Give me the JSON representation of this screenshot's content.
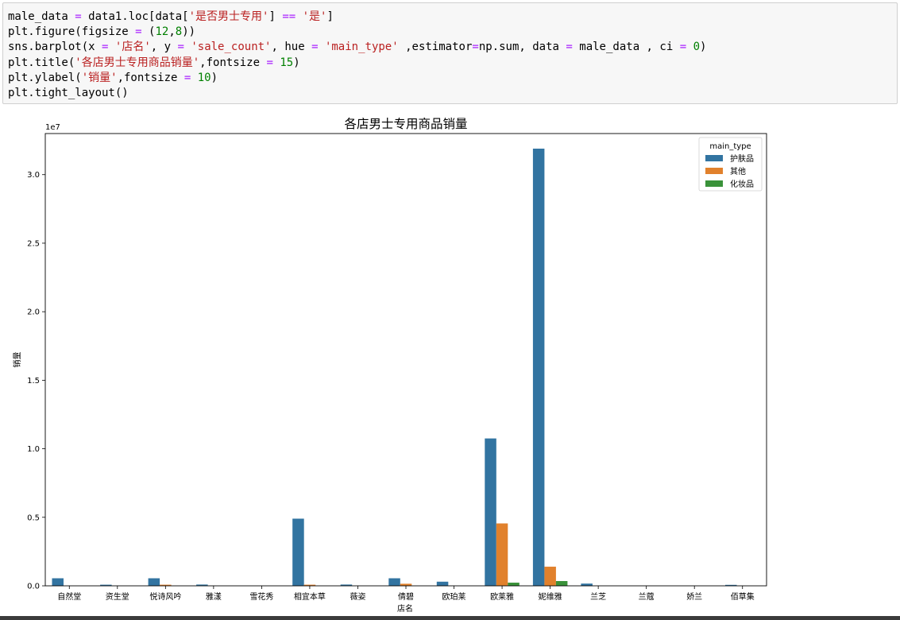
{
  "code_cell": {
    "lines": [
      [
        [
          "male_data ",
          ""
        ],
        [
          "=",
          "op"
        ],
        [
          " data1.loc[data[",
          ""
        ],
        [
          "'是否男士专用'",
          "str"
        ],
        [
          "] ",
          ""
        ],
        [
          "==",
          "op"
        ],
        [
          " ",
          ""
        ],
        [
          "'是'",
          "str"
        ],
        [
          "]",
          ""
        ]
      ],
      [
        [
          "plt.figure(figsize ",
          ""
        ],
        [
          "=",
          "op"
        ],
        [
          " (",
          ""
        ],
        [
          "12",
          "num"
        ],
        [
          ",",
          ""
        ],
        [
          "8",
          "num"
        ],
        [
          "))",
          ""
        ]
      ],
      [
        [
          "sns.barplot(x ",
          ""
        ],
        [
          "=",
          "op"
        ],
        [
          " ",
          ""
        ],
        [
          "'店名'",
          "str"
        ],
        [
          ", y ",
          ""
        ],
        [
          "=",
          "op"
        ],
        [
          " ",
          ""
        ],
        [
          "'sale_count'",
          "str"
        ],
        [
          ", hue ",
          ""
        ],
        [
          "=",
          "op"
        ],
        [
          " ",
          ""
        ],
        [
          "'main_type'",
          "str"
        ],
        [
          " ,estimator",
          ""
        ],
        [
          "=",
          "op"
        ],
        [
          "np.sum, data ",
          ""
        ],
        [
          "=",
          "op"
        ],
        [
          " male_data , ci ",
          ""
        ],
        [
          "=",
          "op"
        ],
        [
          " ",
          ""
        ],
        [
          "0",
          "num"
        ],
        [
          ")",
          ""
        ]
      ],
      [
        [
          "plt.title(",
          ""
        ],
        [
          "'各店男士专用商品销量'",
          "str"
        ],
        [
          ",fontsize ",
          ""
        ],
        [
          "=",
          "op"
        ],
        [
          " ",
          ""
        ],
        [
          "15",
          "num"
        ],
        [
          ")",
          ""
        ]
      ],
      [
        [
          "plt.ylabel(",
          ""
        ],
        [
          "'销量'",
          "str"
        ],
        [
          ",fontsize ",
          ""
        ],
        [
          "=",
          "op"
        ],
        [
          " ",
          ""
        ],
        [
          "10",
          "num"
        ],
        [
          ")",
          ""
        ]
      ],
      [
        [
          "plt.tight_layout()",
          ""
        ]
      ]
    ]
  },
  "chart_data": {
    "type": "bar",
    "title": "各店男士专用商品销量",
    "xlabel": "店名",
    "ylabel": "销量",
    "y_offset_label": "1e7",
    "ylim": [
      0,
      33000000.0
    ],
    "y_ticks": [
      0,
      5000000,
      10000000,
      15000000,
      20000000,
      25000000,
      30000000
    ],
    "y_tick_labels": [
      "0.0",
      "0.5",
      "1.0",
      "1.5",
      "2.0",
      "2.5",
      "3.0"
    ],
    "categories": [
      "自然堂",
      "资生堂",
      "悦诗风吟",
      "雅漾",
      "雪花秀",
      "相宜本草",
      "薇姿",
      "倩碧",
      "欧珀莱",
      "欧莱雅",
      "妮维雅",
      "兰芝",
      "兰蔻",
      "娇兰",
      "佰草集"
    ],
    "legend": {
      "title": "main_type",
      "position": "upper right"
    },
    "series": [
      {
        "name": "护肤品",
        "color": "#3274a1",
        "values": [
          550000,
          80000,
          550000,
          90000,
          0,
          4900000,
          90000,
          550000,
          300000,
          10750000,
          31900000,
          160000,
          0,
          0,
          70000
        ]
      },
      {
        "name": "其他",
        "color": "#e1812c",
        "values": [
          0,
          0,
          80000,
          0,
          0,
          80000,
          0,
          150000,
          0,
          4550000,
          1400000,
          0,
          0,
          0,
          0
        ]
      },
      {
        "name": "化妆品",
        "color": "#3a923a",
        "values": [
          0,
          0,
          0,
          0,
          0,
          0,
          0,
          0,
          0,
          230000,
          350000,
          0,
          0,
          0,
          0
        ]
      }
    ]
  }
}
